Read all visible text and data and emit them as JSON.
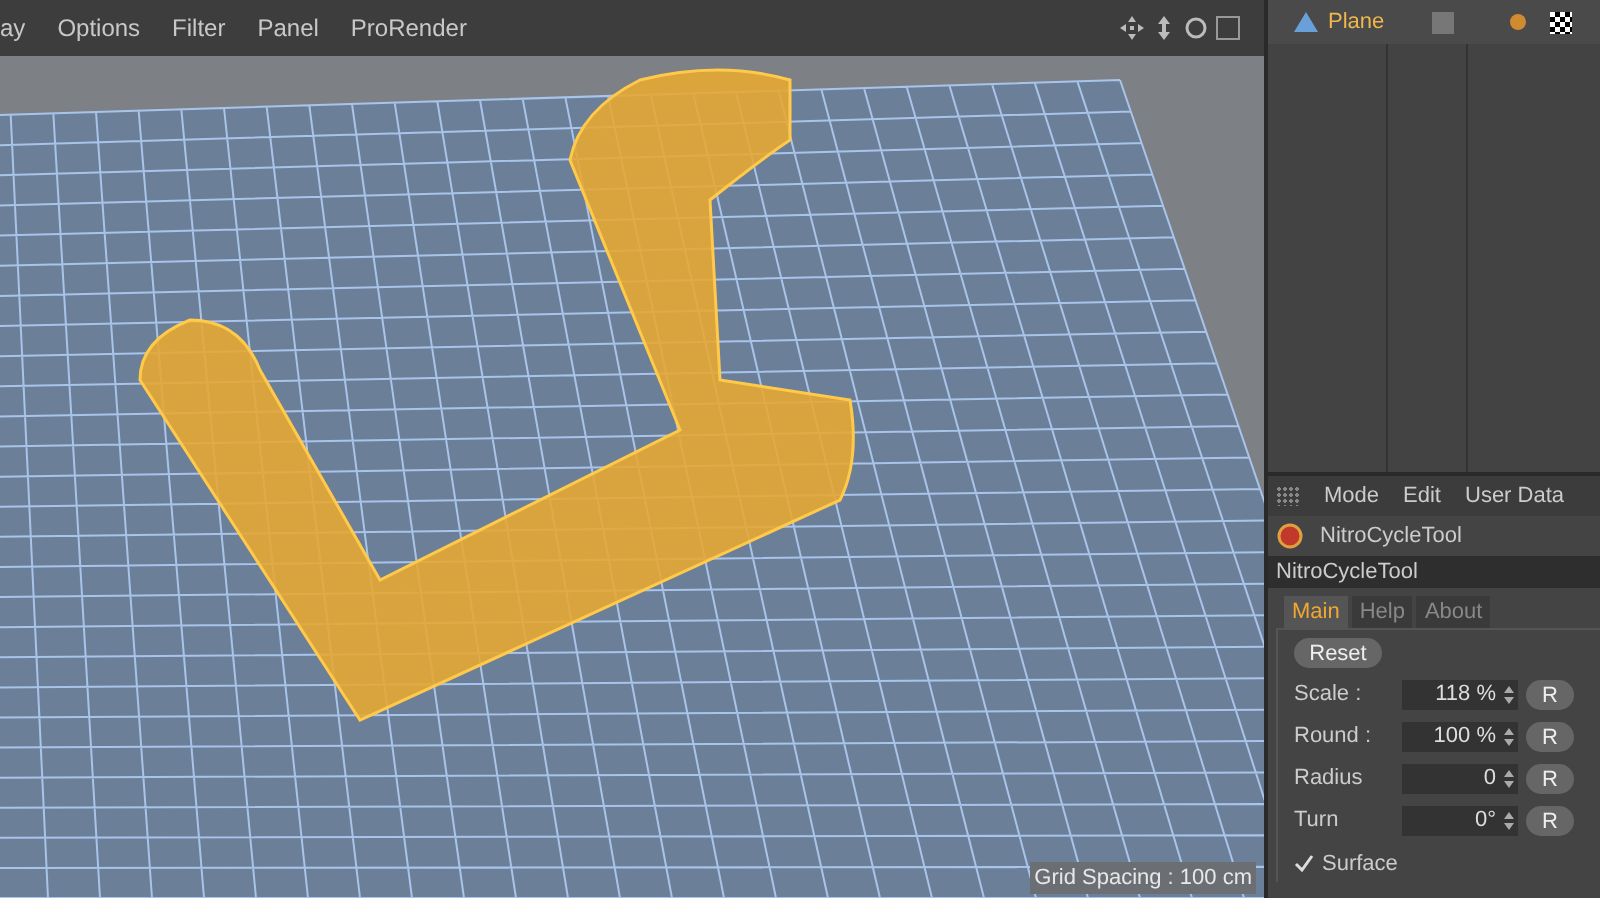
{
  "viewport_menu": [
    "ay",
    "Options",
    "Filter",
    "Panel",
    "ProRender"
  ],
  "viewport": {
    "grid_spacing": "Grid Spacing : 100 cm"
  },
  "object_manager": {
    "objects": [
      {
        "name": "Plane",
        "selected": true
      }
    ]
  },
  "attributes": {
    "menu": [
      "Mode",
      "Edit",
      "User Data"
    ],
    "tool_name": "NitroCycleTool",
    "title": "NitroCycleTool",
    "tabs": [
      {
        "label": "Main",
        "selected": true
      },
      {
        "label": "Help",
        "selected": false
      },
      {
        "label": "About",
        "selected": false
      }
    ],
    "reset": "Reset",
    "fields": [
      {
        "label": "Scale :",
        "value": "118 %",
        "button": "R"
      },
      {
        "label": "Round :",
        "value": "100 %",
        "button": "R"
      },
      {
        "label": "Radius",
        "value": "0",
        "button": "R"
      },
      {
        "label": "Turn",
        "value": "0°",
        "button": "R"
      }
    ],
    "checkbox": {
      "label": "Surface",
      "checked": true
    }
  }
}
